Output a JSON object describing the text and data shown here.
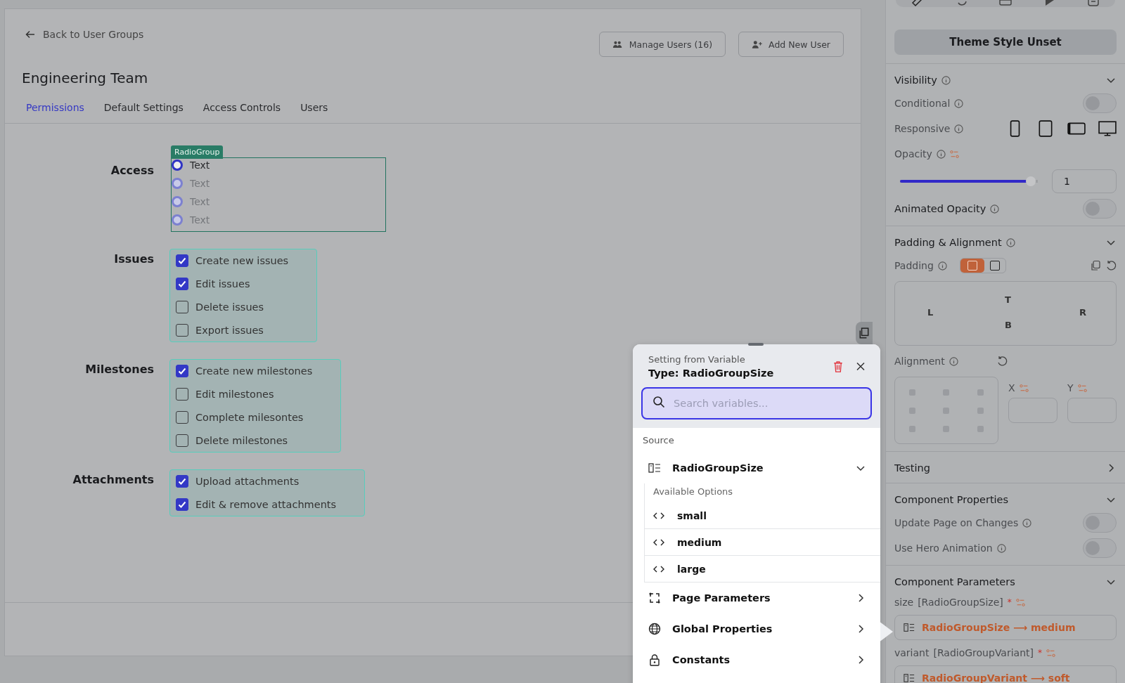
{
  "header": {
    "back_link": "Back to User Groups",
    "buttons": [
      {
        "label": "Manage Users (16)",
        "kind": "users"
      },
      {
        "label": "Add New User",
        "kind": "add-user"
      }
    ],
    "title": "Engineering Team",
    "tabs": [
      {
        "label": "Permissions",
        "selected": true
      },
      {
        "label": "Default Settings",
        "selected": false
      },
      {
        "label": "Access Controls",
        "selected": false
      },
      {
        "label": "Users",
        "selected": false
      }
    ]
  },
  "sections": [
    {
      "label": "Access",
      "kind": "radio",
      "badge": "RadioGroup",
      "items": [
        {
          "label": "Text",
          "selected": true
        },
        {
          "label": "Text",
          "selected": false
        },
        {
          "label": "Text",
          "selected": false
        },
        {
          "label": "Text",
          "selected": false
        }
      ]
    },
    {
      "label": "Issues",
      "kind": "checkbox",
      "items": [
        {
          "label": "Create new issues",
          "checked": true
        },
        {
          "label": "Edit issues",
          "checked": true
        },
        {
          "label": "Delete issues",
          "checked": false
        },
        {
          "label": "Export issues",
          "checked": false
        }
      ]
    },
    {
      "label": "Milestones",
      "kind": "checkbox",
      "items": [
        {
          "label": "Create new milestones",
          "checked": true
        },
        {
          "label": "Edit milestones",
          "checked": false
        },
        {
          "label": "Complete milesontes",
          "checked": false
        },
        {
          "label": "Delete milestones",
          "checked": false
        }
      ]
    },
    {
      "label": "Attachments",
      "kind": "checkbox",
      "items": [
        {
          "label": "Upload attachments",
          "checked": true
        },
        {
          "label": "Edit & remove attachments",
          "checked": true
        }
      ]
    }
  ],
  "popup": {
    "subtitle": "Setting from Variable",
    "title": "Type: RadioGroupSize",
    "search": {
      "placeholder": "Search variables..."
    },
    "source_label": "Source",
    "source": {
      "name": "RadioGroupSize",
      "expanded": true,
      "options_label": "Available Options",
      "options": [
        "small",
        "medium",
        "large"
      ]
    },
    "groups": [
      {
        "label": "Page Parameters",
        "kind": "page"
      },
      {
        "label": "Global Properties",
        "kind": "globe"
      },
      {
        "label": "Constants",
        "kind": "lock"
      }
    ]
  },
  "panel": {
    "theme_button": "Theme Style Unset",
    "visibility": {
      "title": "Visibility",
      "expanded": true,
      "conditional": {
        "label": "Conditional",
        "on": false
      },
      "responsive": "Responsive",
      "opacity": {
        "label": "Opacity",
        "level": 0.95,
        "value": "1"
      },
      "animated": {
        "label": "Animated Opacity",
        "on": false
      }
    },
    "padding": {
      "title": "Padding & Alignment",
      "expanded": true,
      "padding_label": "Padding",
      "sides": [
        "T",
        "L",
        "R",
        "B"
      ],
      "alignment_label": "Alignment",
      "x_label": "X",
      "y_label": "Y"
    },
    "testing": {
      "title": "Testing",
      "expanded": false
    },
    "properties": {
      "title": "Component Properties",
      "expanded": true,
      "toggles": [
        {
          "label": "Update Page on Changes",
          "on": false
        },
        {
          "label": "Use Hero Animation",
          "on": false
        }
      ]
    },
    "parameters": {
      "title": "Component Parameters",
      "expanded": true,
      "items": [
        {
          "name": "size",
          "type": "[RadioGroupSize]",
          "required": "*",
          "value": "RadioGroupSize ⟶ medium"
        },
        {
          "name": "variant",
          "type": "[RadioGroupVariant]",
          "required": "*",
          "value": "RadioGroupVariant ⟶ soft"
        }
      ]
    }
  }
}
